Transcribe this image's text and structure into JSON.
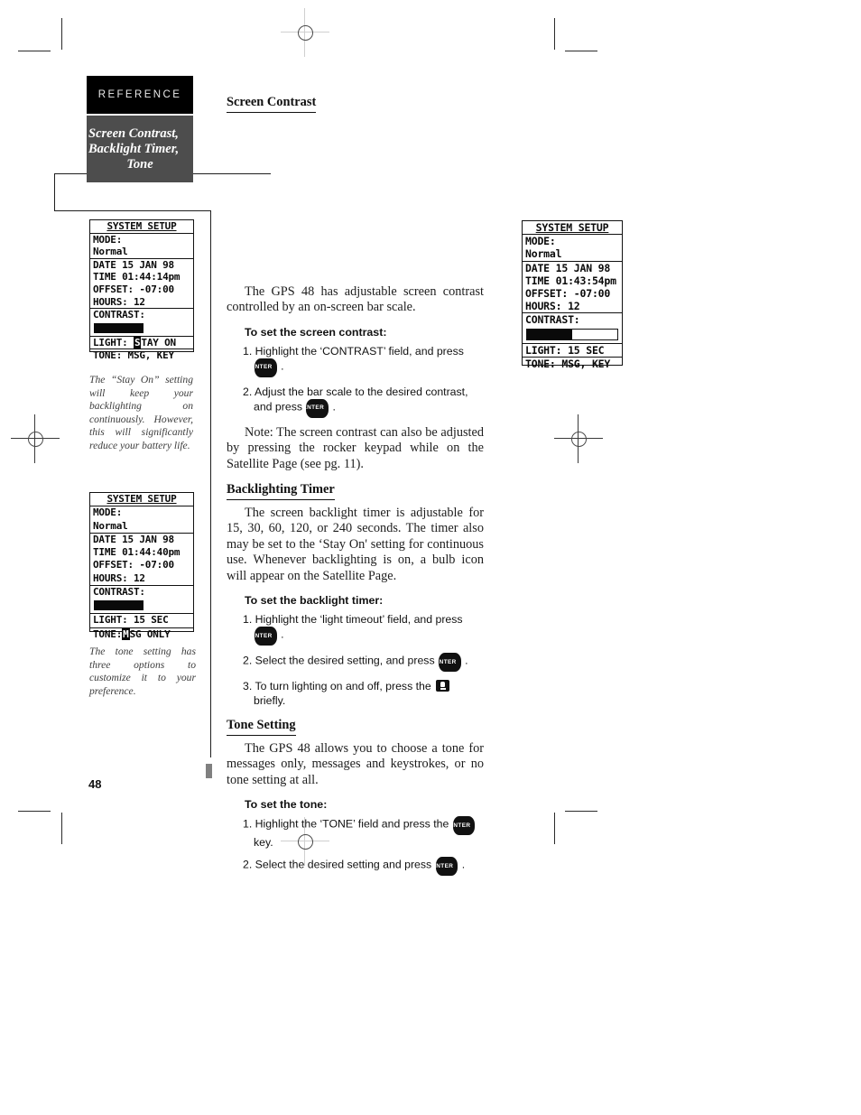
{
  "page": {
    "number": "48",
    "section_tab": "REFERENCE",
    "tab_title_lines": [
      "Screen Contrast,",
      "Backlight Timer,",
      "Tone"
    ]
  },
  "gps_screens": {
    "main": {
      "title": "SYSTEM SETUP",
      "mode_label": "MODE:",
      "mode_value": "Normal",
      "date": "DATE  15 JAN 98",
      "time": "TIME 01:43:54pm",
      "offset": "OFFSET: -07:00",
      "hours": "HOURS:  12",
      "contrast_label": "CONTRAST:",
      "contrast_percent": 50,
      "light": "LIGHT: 15 SEC",
      "tone": "TONE: MSG, KEY"
    },
    "side_1": {
      "title": "SYSTEM SETUP",
      "mode_label": "MODE:",
      "mode_value": "Normal",
      "date": "DATE  15 JAN 98",
      "time": "TIME 01:44:14pm",
      "offset": "OFFSET: -07:00",
      "hours": "HOURS:  12",
      "contrast_label": "CONTRAST:",
      "contrast_percent": 52,
      "light_prefix": "LIGHT: ",
      "light_highlight": "S",
      "light_suffix": "TAY ON",
      "tone": "TONE: MSG, KEY"
    },
    "side_2": {
      "title": "SYSTEM SETUP",
      "mode_label": "MODE:",
      "mode_value": "Normal",
      "date": "DATE  15 JAN 98",
      "time": "TIME 01:44:40pm",
      "offset": "OFFSET: -07:00",
      "hours": "HOURS:  12",
      "contrast_label": "CONTRAST:",
      "contrast_percent": 52,
      "light": "LIGHT: 15 SEC",
      "tone_prefix": "TONE:",
      "tone_highlight": "M",
      "tone_suffix": "SG ONLY"
    }
  },
  "captions": {
    "caption_1": "The “Stay On” setting will keep your backlighting on continuously.  However, this will significantly reduce your battery life.",
    "caption_2": "The tone setting has three options to customize it to your preference."
  },
  "sections": {
    "screen_contrast": {
      "heading": "Screen Contrast",
      "intro": "The GPS 48 has adjustable screen contrast controlled by an on-screen bar scale.",
      "sub_heading": "To set the screen contrast:",
      "steps": [
        {
          "pre": "1. Highlight the ‘CONTRAST’ field, and press",
          "key": "ENTER",
          "post": "."
        },
        {
          "pre": "2. Adjust the bar scale to the desired contrast, and press",
          "key": "ENTER",
          "post": "."
        }
      ],
      "note": "Note: The screen contrast can also be adjusted by pressing the rocker keypad while on the Satellite Page (see pg. 11)."
    },
    "backlighting_timer": {
      "heading": "Backlighting Timer",
      "intro": "The screen backlight timer is adjustable for 15, 30, 60, 120, or 240 seconds.  The timer also may be set to the ‘Stay On' setting for continuous use.  Whenever backlighting is on, a bulb icon will appear on the Satellite Page.",
      "sub_heading": "To set the backlight timer:",
      "steps": [
        {
          "pre": "1. Highlight the ‘light timeout’ field, and press",
          "key": "ENTER",
          "post": "."
        },
        {
          "pre": "2. Select the desired setting, and press",
          "key": "ENTER",
          "post": "."
        },
        {
          "pre": "3. To turn lighting on and off, press the",
          "key": "LAMP",
          "post": "briefly."
        }
      ]
    },
    "tone_setting": {
      "heading": "Tone Setting",
      "intro": "The GPS 48 allows you to choose a tone for messages only, messages and keystrokes, or no tone setting at all.",
      "sub_heading": "To set the tone:",
      "steps": [
        {
          "pre": "1. Highlight the ‘TONE’ field and press the",
          "key": "ENTER",
          "post": "key."
        },
        {
          "pre": "2. Select the desired setting and press",
          "key": "ENTER",
          "post": "."
        }
      ]
    }
  }
}
